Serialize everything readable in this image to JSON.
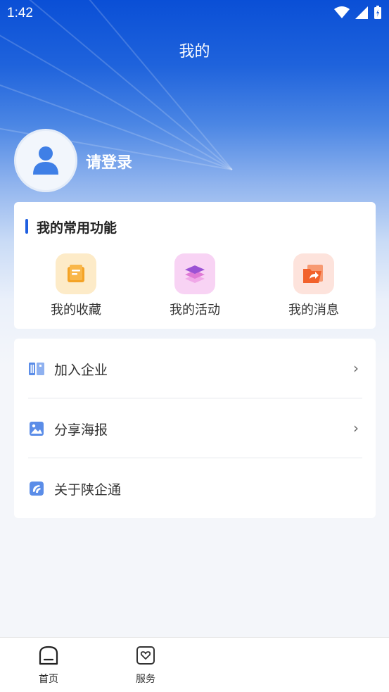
{
  "status_bar": {
    "time": "1:42"
  },
  "page": {
    "title": "我的"
  },
  "profile": {
    "login_label": "请登录"
  },
  "common_functions": {
    "title": "我的常用功能",
    "items": [
      {
        "label": "我的收藏",
        "icon": "favorites-icon",
        "bg": "#fdebc8"
      },
      {
        "label": "我的活动",
        "icon": "activity-icon",
        "bg": "#f8d3f4"
      },
      {
        "label": "我的消息",
        "icon": "message-icon",
        "bg": "#fde3dc"
      }
    ]
  },
  "menu": {
    "items": [
      {
        "label": "加入企业",
        "icon": "enterprise-icon",
        "chevron": "›"
      },
      {
        "label": "分享海报",
        "icon": "poster-icon",
        "chevron": "›"
      },
      {
        "label": "关于陕企通",
        "icon": "about-icon"
      }
    ]
  },
  "tabbar": {
    "items": [
      {
        "label": "首页",
        "icon": "home-icon"
      },
      {
        "label": "服务",
        "icon": "service-icon"
      }
    ]
  },
  "colors": {
    "accent": "#1f5fe0",
    "icon_blue": "#5b8de8"
  }
}
